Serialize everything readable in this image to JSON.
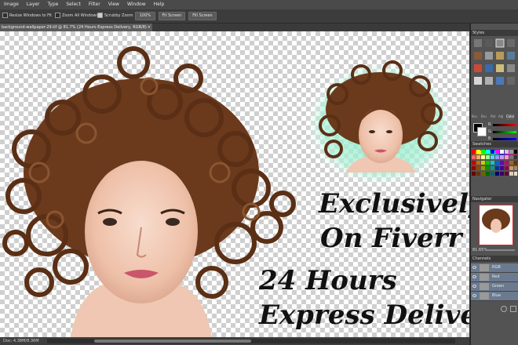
{
  "menu": [
    "Image",
    "Layer",
    "Type",
    "Select",
    "Filter",
    "View",
    "Window",
    "Help"
  ],
  "options": {
    "resize_windows": "Resize Windows to Fit",
    "zoom_all": "Zoom All Windows",
    "scrubby_zoom": "Scrubby Zoom",
    "btn_100": "100%",
    "btn_fit": "Fit Screen",
    "btn_fill": "Fill Screen"
  },
  "document": {
    "tab_title": "background-wallpaper-29.tif @ 81.7% (24 Hours Express Delivery, RGB/8)",
    "close": "×"
  },
  "canvas_text": {
    "line1": "Exclusively",
    "line2": "On Fiverr",
    "line3": "24 Hours",
    "line4": "Express Delivery"
  },
  "status": {
    "doc": "Doc: 4.38M/8.36M"
  },
  "panels": {
    "styles": "Styles",
    "color_tabs": [
      "Bru",
      "Bru",
      "Pat",
      "Adj",
      "Color"
    ],
    "color_labels": [
      "R",
      "G",
      "B"
    ],
    "swatches": "Swatches",
    "navigator": "Navigator",
    "zoom": "81.65%",
    "channels": "Channels",
    "channel_list": [
      "RGB",
      "Red",
      "Green",
      "Blue"
    ]
  },
  "colors": {
    "accent_glow": "#7ee8c0",
    "hair": "#5a2f15",
    "selected_channel": "#6b7a8f"
  }
}
